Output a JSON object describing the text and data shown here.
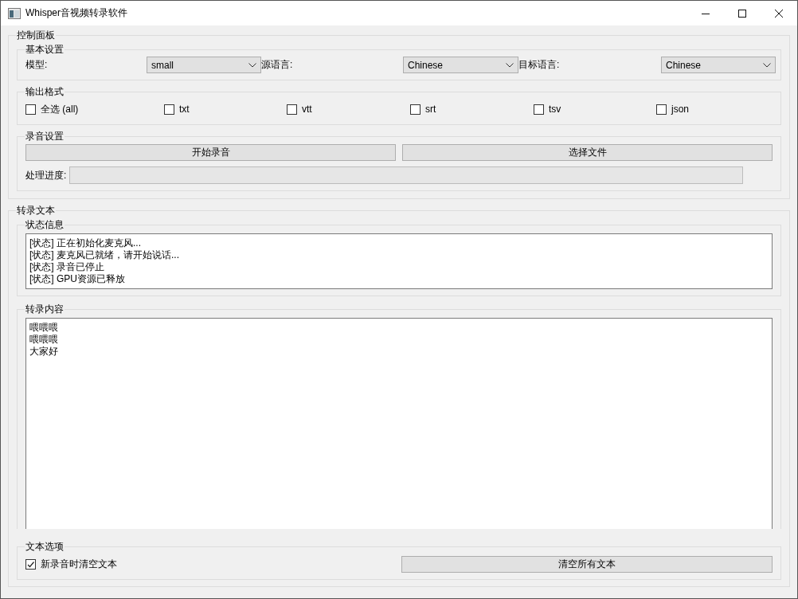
{
  "window": {
    "title": "Whisper音视频转录软件"
  },
  "control_panel": {
    "title": "控制面板",
    "basic_settings": {
      "title": "基本设置",
      "fields": [
        {
          "label": "模型:",
          "value": "small"
        },
        {
          "label": "源语言:",
          "value": "Chinese"
        },
        {
          "label": "目标语言:",
          "value": "Chinese"
        }
      ]
    },
    "output_format": {
      "title": "输出格式",
      "options": [
        {
          "label": "全选 (all)",
          "checked": false
        },
        {
          "label": "txt",
          "checked": false
        },
        {
          "label": "vtt",
          "checked": false
        },
        {
          "label": "srt",
          "checked": false
        },
        {
          "label": "tsv",
          "checked": false
        },
        {
          "label": "json",
          "checked": false
        }
      ]
    },
    "recording": {
      "title": "录音设置",
      "buttons": [
        "开始录音",
        "选择文件"
      ],
      "progress": {
        "label": "处理进度:",
        "level": 0
      }
    }
  },
  "transcript": {
    "title": "转录文本",
    "status": {
      "title": "状态信息",
      "lines": [
        "[状态] 正在初始化麦克风...",
        "[状态] 麦克风已就绪，请开始说话...",
        "[状态] 录音已停止",
        "[状态] GPU资源已释放"
      ]
    },
    "content": {
      "title": "转录内容",
      "lines": [
        "喂喂喂",
        "喂喂喂",
        "大家好"
      ]
    },
    "text_options": {
      "title": "文本选项",
      "clear_on_new": {
        "label": "新录音时清空文本",
        "checked": true
      },
      "button": "清空所有文本"
    }
  }
}
